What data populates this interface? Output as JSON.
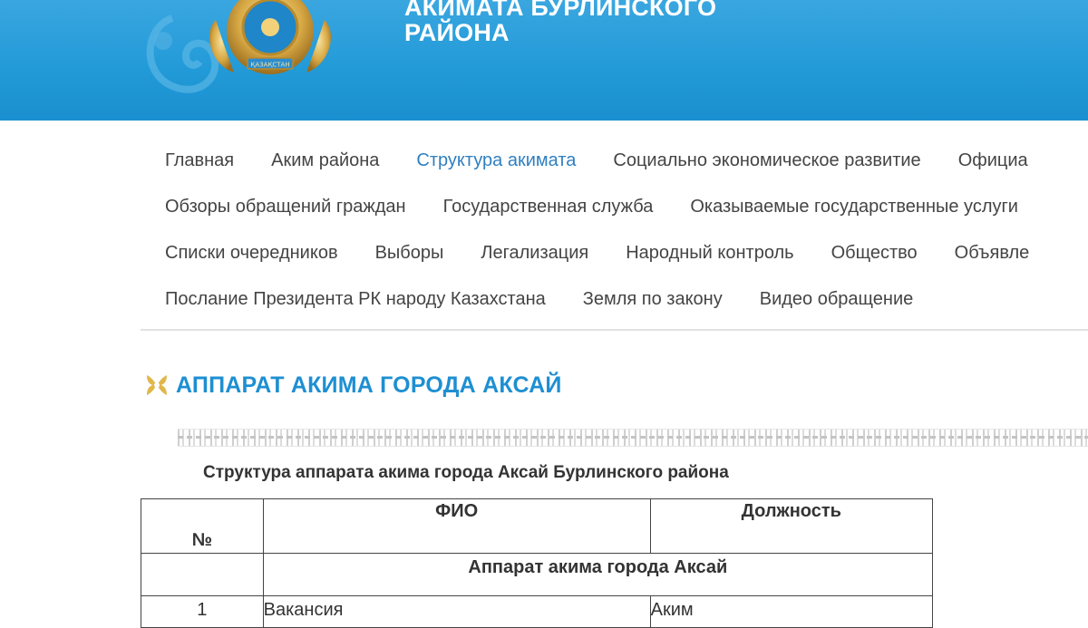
{
  "header": {
    "title_line1": "АКИМАТА БУРЛИНСКОГО",
    "title_line2": "РАЙОНА",
    "emblem_icon": "kazakhstan-emblem-icon",
    "emblem_ribbon_text": "ҚАЗАҚСТАН"
  },
  "nav": {
    "rows": [
      [
        {
          "label": "Главная",
          "active": false
        },
        {
          "label": "Аким района",
          "active": false
        },
        {
          "label": "Структура акимата",
          "active": true
        },
        {
          "label": "Социально экономическое развитие",
          "active": false
        },
        {
          "label": "Официа",
          "active": false
        }
      ],
      [
        {
          "label": "Обзоры обращений граждан",
          "active": false
        },
        {
          "label": "Государственная служба",
          "active": false
        },
        {
          "label": "Оказываемые государственные услуги",
          "active": false
        }
      ],
      [
        {
          "label": "Списки очередников",
          "active": false
        },
        {
          "label": "Выборы",
          "active": false
        },
        {
          "label": "Легализация",
          "active": false
        },
        {
          "label": "Народный контроль",
          "active": false
        },
        {
          "label": "Общество",
          "active": false
        },
        {
          "label": "Объявле",
          "active": false
        }
      ],
      [
        {
          "label": "Послание Президента РК народу Казахстана",
          "active": false
        },
        {
          "label": "Земля по закону",
          "active": false
        },
        {
          "label": "Видео обращение",
          "active": false
        }
      ]
    ]
  },
  "section": {
    "icon": "ornament-icon",
    "title": "АППАРАТ АКИМА ГОРОДА АКСАЙ"
  },
  "content": {
    "subtitle": "Структура аппарата акима города Аксай Бурлинского района",
    "table": {
      "headers": {
        "num": "№",
        "fio": "ФИО",
        "position": "Должность"
      },
      "group_title": "Аппарат акима города Аксай",
      "rows": [
        {
          "num": "1",
          "fio": "Вакансия",
          "position": "Аким"
        }
      ]
    }
  },
  "colors": {
    "banner": "#239bd8",
    "nav_active": "#2f7fc0",
    "heading": "#1e8fd2",
    "icon_gold": "#e0b84a"
  }
}
